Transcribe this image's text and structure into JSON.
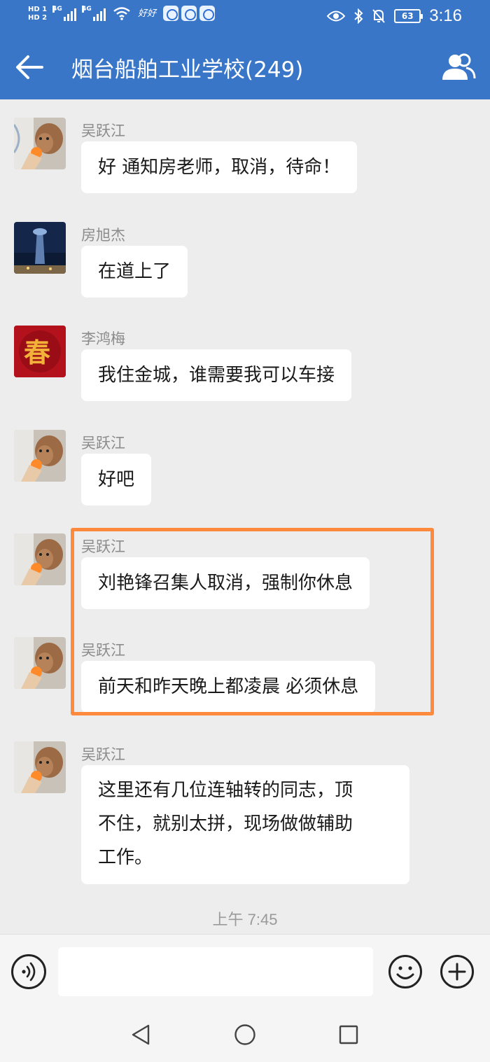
{
  "status_bar": {
    "hd1": "HD 1",
    "hd2": "HD 2",
    "net1": "4G",
    "net2": "4G",
    "handwriting": "好好",
    "battery": "63",
    "time": "3:16"
  },
  "header": {
    "title": "烟台船舶工业学校(249)"
  },
  "messages": [
    {
      "sender": "吴跃江",
      "text": "好 通知房老师，取消，待命！"
    },
    {
      "sender": "房旭杰",
      "text": "在道上了"
    },
    {
      "sender": "李鸿梅",
      "text": "我住金城，谁需要我可以车接"
    },
    {
      "sender": "吴跃江",
      "text": "好吧"
    },
    {
      "sender": "吴跃江",
      "text": "刘艳锋召集人取消，强制你休息"
    },
    {
      "sender": "吴跃江",
      "text": "前天和昨天晚上都凌晨 必须休息"
    },
    {
      "sender": "吴跃江",
      "lines": [
        "这里还有几位连轴转的同志，顶",
        "不住，就别太拼，现场做做辅助",
        "工作。"
      ]
    }
  ],
  "timestamp": "上午 7:45",
  "avatar_text": {
    "chun": "春"
  },
  "colors": {
    "header_bg": "#3a76c8",
    "highlight": "#ff8a3d",
    "chat_bg": "#ededed"
  },
  "icons": [
    "back-arrow-icon",
    "group-members-icon",
    "voice-icon",
    "emoji-icon",
    "plus-icon",
    "nav-back-icon",
    "nav-home-icon",
    "nav-recent-icon"
  ]
}
